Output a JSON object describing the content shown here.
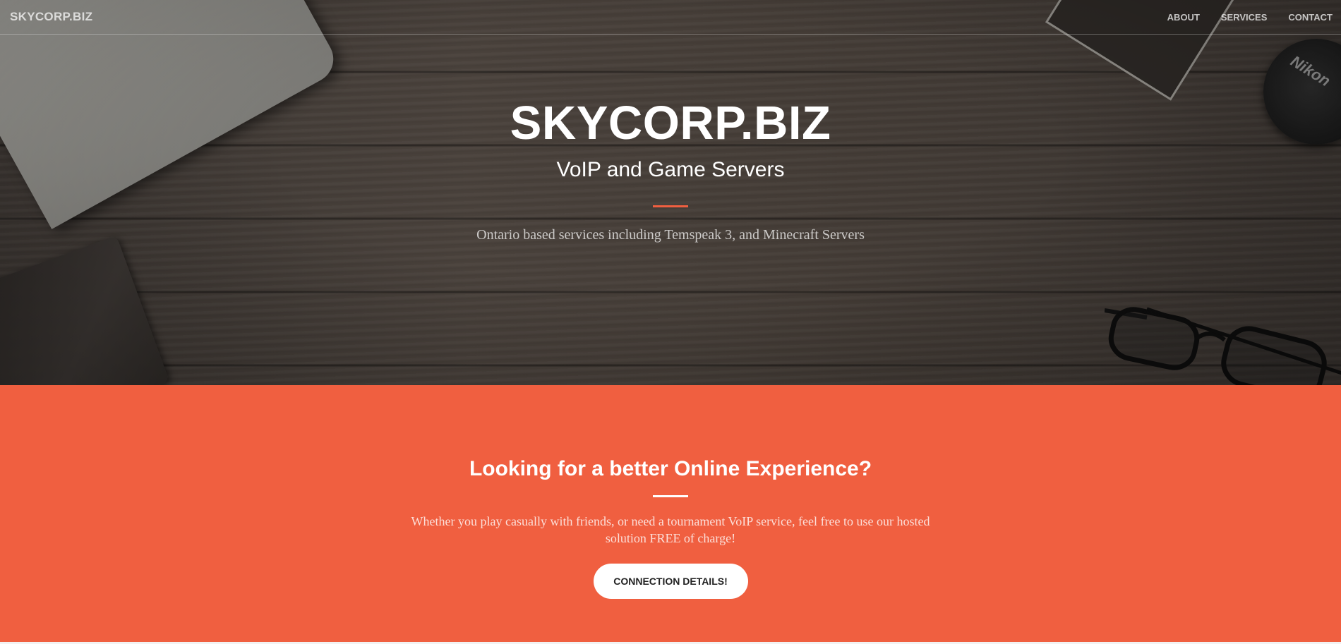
{
  "navbar": {
    "brand": "SKYCORP.BIZ",
    "links": [
      "ABOUT",
      "SERVICES",
      "CONTACT"
    ]
  },
  "hero": {
    "title": "SKYCORP.BIZ",
    "subtitle": "VoIP and Game Servers",
    "description": "Ontario based services including Temspeak 3, and Minecraft Servers",
    "lens_brand": "Nikon"
  },
  "cta": {
    "title": "Looking for a better Online Experience?",
    "text": "Whether you play casually with friends, or need a tournament VoIP service, feel free to use our hosted solution FREE of charge!",
    "button_label": "CONNECTION DETAILS!"
  },
  "colors": {
    "accent": "#f05f40",
    "hero_wood": "#433b35",
    "white": "#ffffff"
  }
}
